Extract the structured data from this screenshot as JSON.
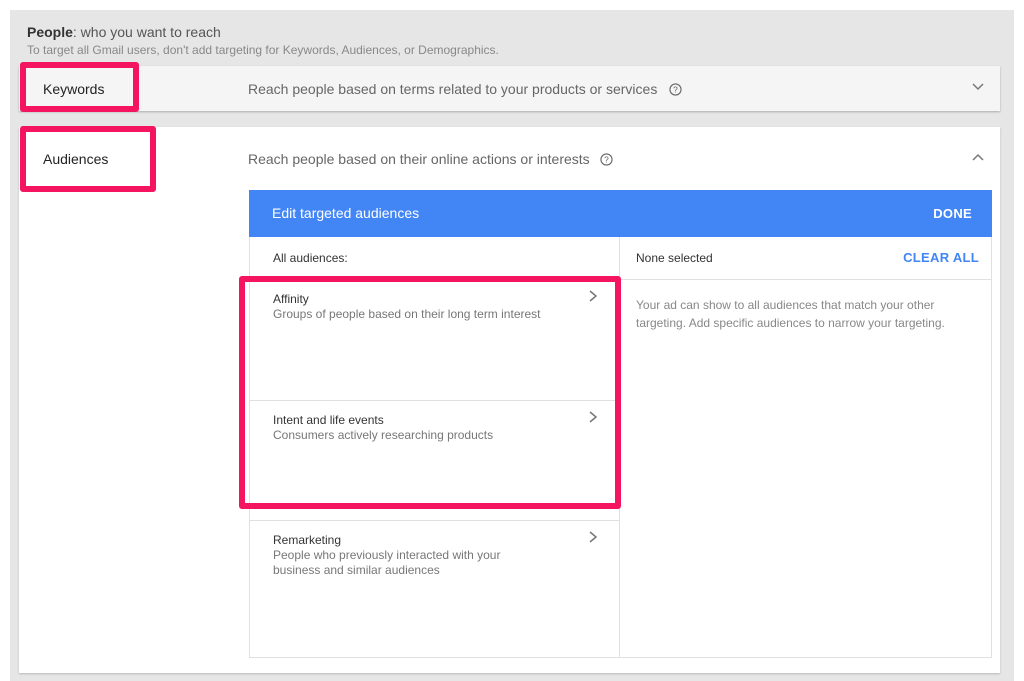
{
  "header": {
    "title_bold": "People",
    "title_rest": ": who you want to reach",
    "subtitle": "To target all Gmail users, don't add targeting for Keywords, Audiences, or Demographics."
  },
  "keywords": {
    "label": "Keywords",
    "description": "Reach people based on terms related to your products or services",
    "help_icon": "help-circle-icon",
    "expand_icon": "chevron-down-icon"
  },
  "audiences": {
    "label": "Audiences",
    "description": "Reach people based on their online actions or interests",
    "help_icon": "help-circle-icon",
    "collapse_icon": "chevron-up-icon",
    "editor": {
      "title": "Edit targeted audiences",
      "done_label": "DONE",
      "all_audiences_label": "All audiences:",
      "items": [
        {
          "title": "Affinity",
          "subtitle": "Groups of people based on their long term interest"
        },
        {
          "title": "Intent and life events",
          "subtitle": "Consumers actively researching products"
        },
        {
          "title": "Remarketing",
          "subtitle": "People who previously interacted with your business and similar audiences"
        }
      ],
      "selection_status": "None selected",
      "clear_all_label": "CLEAR ALL",
      "selection_message": "Your ad can show to all audiences that match your other targeting. Add specific audiences to narrow your targeting."
    }
  },
  "colors": {
    "accent": "#4285f4",
    "highlight": "#f5145f"
  }
}
